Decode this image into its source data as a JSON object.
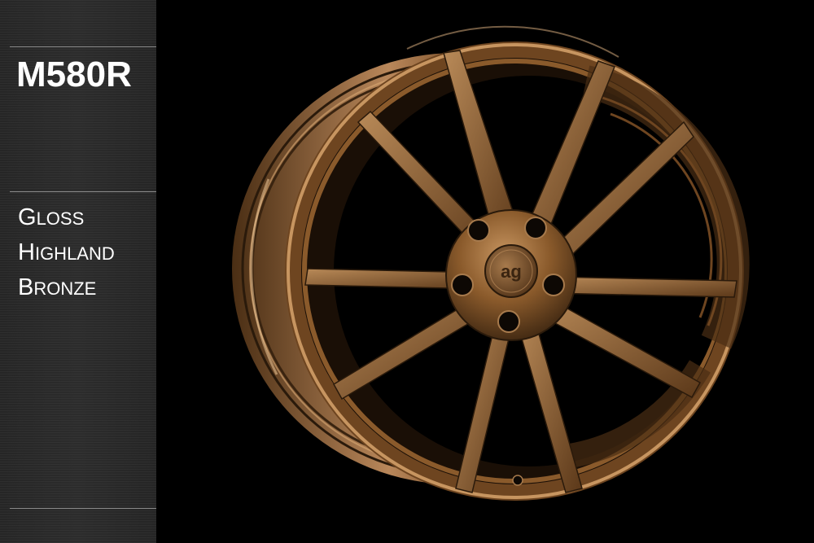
{
  "sidebar": {
    "model": "M580R",
    "finish_words": [
      {
        "initial": "G",
        "rest": "LOSS"
      },
      {
        "initial": "H",
        "rest": "IGHLAND"
      },
      {
        "initial": "B",
        "rest": "RONZE"
      }
    ]
  },
  "photo": {
    "subject": "wheel-photo",
    "center_cap_logo": "ag",
    "colors": {
      "bronze": "#8a5a2b",
      "bronze_highlight": "#c79560",
      "bronze_dark": "#3a2410",
      "background": "#000000"
    }
  }
}
